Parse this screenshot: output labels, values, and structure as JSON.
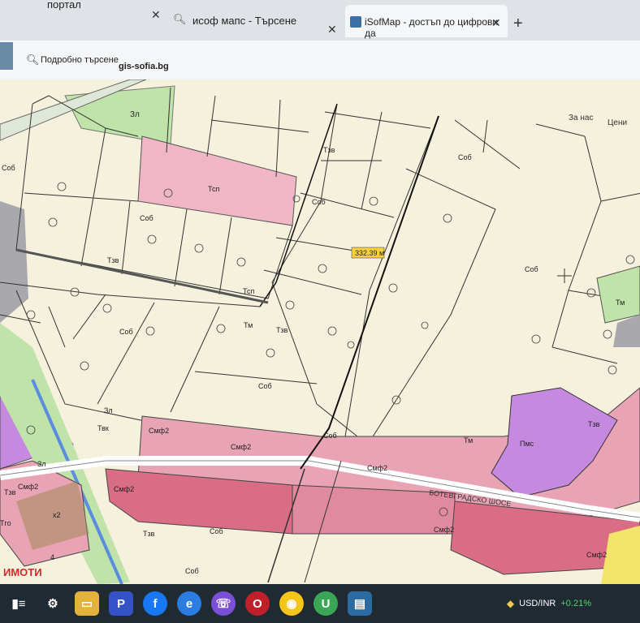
{
  "browser": {
    "tabs": [
      {
        "label": "портал"
      },
      {
        "label": "исоф мапс - Търсене"
      },
      {
        "label": "iSofMap - достъп до цифрови да"
      }
    ],
    "new_tab_symbol": "+",
    "close_symbol": "✕",
    "bookmarks": [
      {
        "label": "Подробно търсене"
      },
      {
        "label": "gis-sofia.bg"
      }
    ]
  },
  "map": {
    "top_links": {
      "about": "За нас",
      "prices": "Цени"
    },
    "measure_label": "332.39 м",
    "zones": {
      "zl": "Зл",
      "sob": "Соб",
      "tsp": "Тсп",
      "tzv": "Тзв",
      "tm": "Тм",
      "smf2": "Смф2",
      "pus": "Пмс",
      "tgo": "Тго",
      "tvk": "Твк",
      "x2": "x2",
      "num4": "4"
    },
    "road_label": "БОТЕВГРАДСКО ШОСЕ",
    "watermark": "ИМОТИ"
  },
  "taskbar": {
    "currency": "USD/INR",
    "change": "+0.21%",
    "icons": [
      "task-view-icon",
      "settings-icon",
      "file-explorer-icon",
      "p-app-icon",
      "facebook-icon",
      "edge-icon",
      "viber-icon",
      "opera-icon",
      "chrome-icon",
      "upwork-icon",
      "map-app-icon"
    ]
  },
  "colors": {
    "pink_zone": "#e8a3b4",
    "dark_pink": "#d96d86",
    "purple_zone": "#c58ae0",
    "green_zone": "#bfe3a8",
    "parcel": "#f6f1dc"
  }
}
